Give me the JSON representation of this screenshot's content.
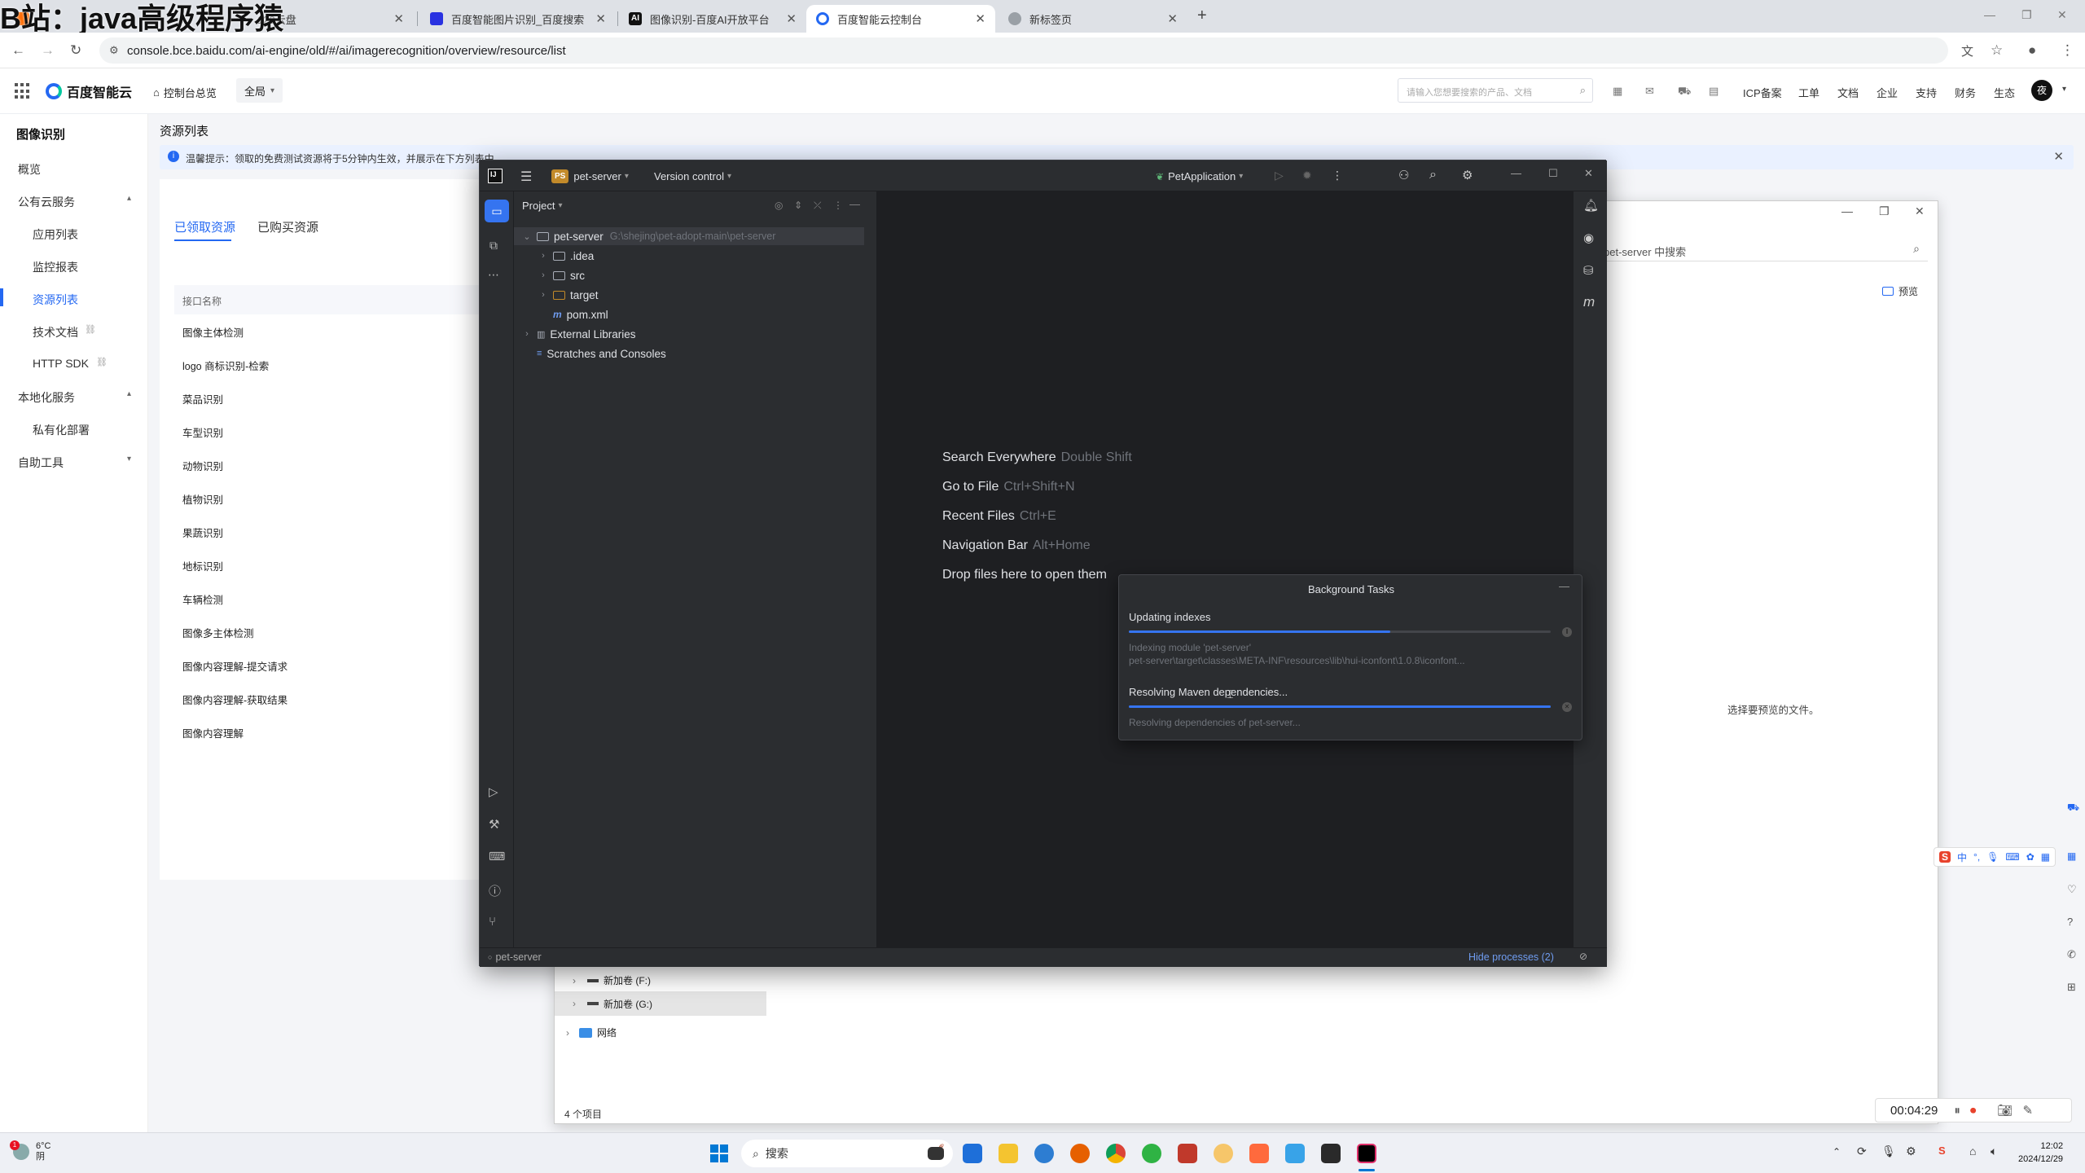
{
  "watermark": "B站：java高级程序猿",
  "browser": {
    "tabs": [
      {
        "title": "123云盘",
        "active": false
      },
      {
        "title": "百度智能图片识别_百度搜索",
        "active": false
      },
      {
        "title": "图像识别-百度AI开放平台",
        "active": false
      },
      {
        "title": "百度智能云控制台",
        "active": true
      },
      {
        "title": "新标签页",
        "active": false
      }
    ],
    "url": "console.bce.baidu.com/ai-engine/old/#/ai/imagerecognition/overview/resource/list"
  },
  "bce_header": {
    "logo_text": "百度智能云",
    "overview": "控制台总览",
    "region": "全局",
    "search_placeholder": "请输入您想要搜索的产品、文档",
    "links": [
      "ICP备案",
      "工单",
      "文档",
      "企业",
      "支持",
      "财务",
      "生态"
    ],
    "avatar": "夜"
  },
  "left_menu": {
    "title": "图像识别",
    "items": [
      {
        "label": "概览",
        "level": 0
      },
      {
        "label": "公有云服务",
        "level": 0
      },
      {
        "label": "应用列表",
        "level": 1
      },
      {
        "label": "监控报表",
        "level": 1
      },
      {
        "label": "资源列表",
        "level": 1,
        "active": true
      },
      {
        "label": "技术文档",
        "level": 1
      },
      {
        "label": "HTTP SDK",
        "level": 1
      },
      {
        "label": "本地化服务",
        "level": 0
      },
      {
        "label": "私有化部署",
        "level": 1
      },
      {
        "label": "自助工具",
        "level": 0
      }
    ]
  },
  "content": {
    "page_title": "资源列表",
    "notice": "温馨提示：领取的免费测试资源将于5分钟内生效，并展示在下方列表中",
    "tabs": [
      "已领取资源",
      "已购买资源"
    ],
    "table_header": "接口名称",
    "rows": [
      "图像主体检测",
      "logo 商标识别-检索",
      "菜品识别",
      "车型识别",
      "动物识别",
      "植物识别",
      "果蔬识别",
      "地标识别",
      "车辆检测",
      "图像多主体检测",
      "图像内容理解-提交请求",
      "图像内容理解-获取结果",
      "图像内容理解"
    ]
  },
  "explorer": {
    "search_placeholder": "pet-server 中搜索",
    "preview_label": "预览",
    "empty_preview": "选择要预览的文件。",
    "drives": [
      "新加卷 (F:)",
      "新加卷 (G:)"
    ],
    "network": "网络",
    "status": "4 个项目"
  },
  "ide": {
    "project_badge": "PS",
    "project_name": "pet-server",
    "vcs": "Version control",
    "run_config": "PetApplication",
    "panel_title": "Project",
    "tree": {
      "root": "pet-server",
      "root_path": "G:\\shejing\\pet-adopt-main\\pet-server",
      "children": [
        ".idea",
        "src",
        "target",
        "pom.xml"
      ],
      "external": "External Libraries",
      "scratches": "Scratches and Consoles"
    },
    "hints": [
      {
        "label": "Search Everywhere",
        "key": "Double Shift"
      },
      {
        "label": "Go to File",
        "key": "Ctrl+Shift+N"
      },
      {
        "label": "Recent Files",
        "key": "Ctrl+E"
      },
      {
        "label": "Navigation Bar",
        "key": "Alt+Home"
      },
      {
        "label": "Drop files here to open them",
        "key": ""
      }
    ],
    "bg_tasks": {
      "title": "Background Tasks",
      "task1": {
        "title": "Updating indexes",
        "progress": 0.62,
        "detail1": "Indexing module 'pet-server'",
        "detail2": "pet-server\\target\\classes\\META-INF\\resources\\lib\\hui-iconfont\\1.0.8\\iconfont..."
      },
      "task2": {
        "title": "Resolving Maven dependencies...",
        "progress": 1.0,
        "detail": "Resolving dependencies of pet-server..."
      }
    },
    "status_left": "pet-server",
    "status_right": "Hide processes (2)"
  },
  "recorder": {
    "time": "00:04:29"
  },
  "taskbar": {
    "weather_temp": "6°C",
    "weather_desc": "阴",
    "search_label": "搜索",
    "time": "12:02",
    "date": "2024/12/29",
    "ime": "中"
  },
  "colors": {
    "accent_blue": "#2468f2",
    "ide_bg": "#1e1f22",
    "ide_panel": "#2b2d30",
    "progress": "#3574f0"
  }
}
